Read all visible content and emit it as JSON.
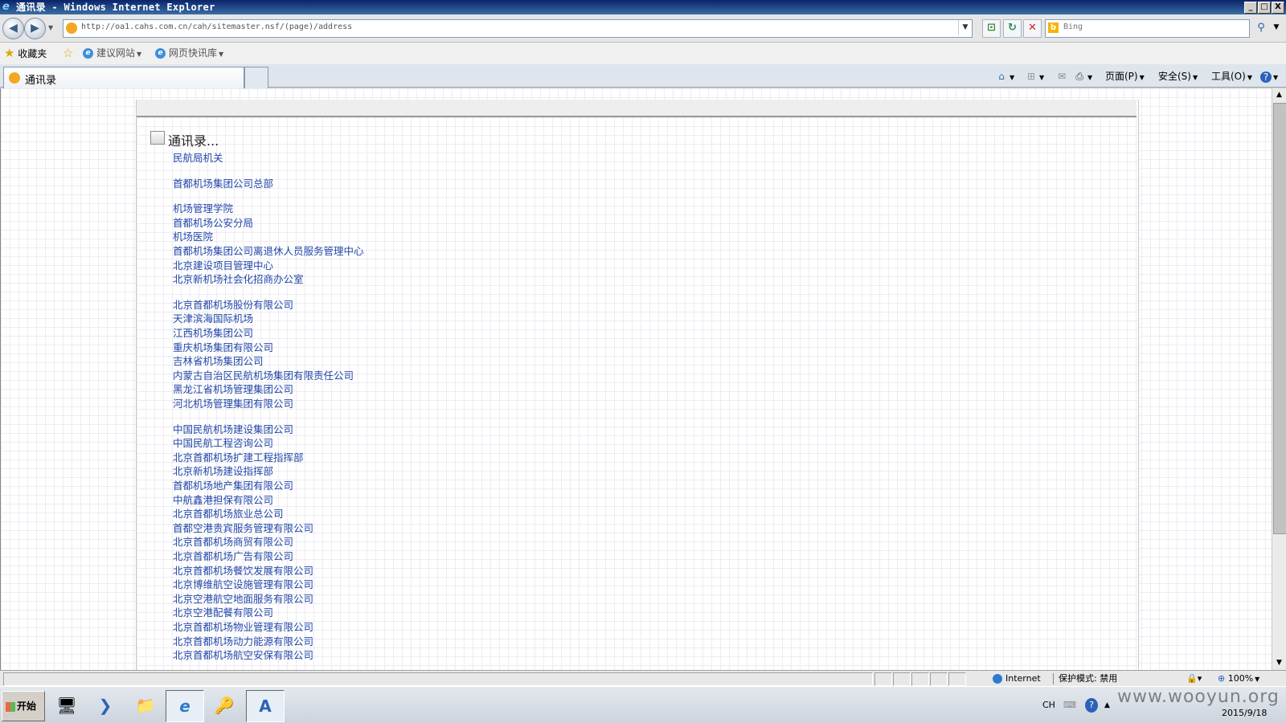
{
  "window": {
    "title": "通讯录 - Windows Internet Explorer",
    "min": "_",
    "max": "□",
    "close": "X"
  },
  "nav": {
    "back": "◀",
    "forward": "▶",
    "url": "http://oa1.cahs.com.cn/cah/sitemaster.nsf/(page)/address",
    "search_placeholder": "Bing"
  },
  "favorites": {
    "label": "收藏夹",
    "items": [
      "建议网站",
      "网页快讯库"
    ]
  },
  "tab": {
    "title": "通讯录"
  },
  "commandbar": {
    "page": "页面(P)",
    "safety": "安全(S)",
    "tools": "工具(O)"
  },
  "directory": {
    "title": "通讯录...",
    "groups": [
      [
        "民航局机关"
      ],
      [
        "首都机场集团公司总部"
      ],
      [
        "机场管理学院",
        "首都机场公安分局",
        "机场医院",
        "首都机场集团公司离退休人员服务管理中心",
        "北京建设项目管理中心",
        "北京新机场社会化招商办公室"
      ],
      [
        "北京首都机场股份有限公司",
        "天津滨海国际机场",
        "江西机场集团公司",
        "重庆机场集团有限公司",
        "吉林省机场集团公司",
        "内蒙古自治区民航机场集团有限责任公司",
        "黑龙江省机场管理集团公司",
        "河北机场管理集团有限公司"
      ],
      [
        "中国民航机场建设集团公司",
        "中国民航工程咨询公司",
        "北京首都机场扩建工程指挥部",
        "北京新机场建设指挥部",
        "首都机场地产集团有限公司",
        "中航鑫港担保有限公司",
        "北京首都机场旅业总公司",
        "首都空港贵宾服务管理有限公司",
        "北京首都机场商贸有限公司",
        "北京首都机场广告有限公司",
        "北京首都机场餐饮发展有限公司",
        "北京博维航空设施管理有限公司",
        "北京空港航空地面服务有限公司",
        "北京空港配餐有限公司",
        "北京首都机场物业管理有限公司",
        "北京首都机场动力能源有限公司",
        "北京首都机场航空安保有限公司"
      ]
    ]
  },
  "statusbar": {
    "zone": "Internet",
    "protected_mode": "保护模式: 禁用",
    "zoom": "100%"
  },
  "taskbar": {
    "start": "开始",
    "lang": "CH",
    "date": "2015/9/18",
    "watermark": "www.wooyun.org"
  },
  "colors": {
    "link": "#2347a8",
    "titlebar": "#0a246a"
  }
}
